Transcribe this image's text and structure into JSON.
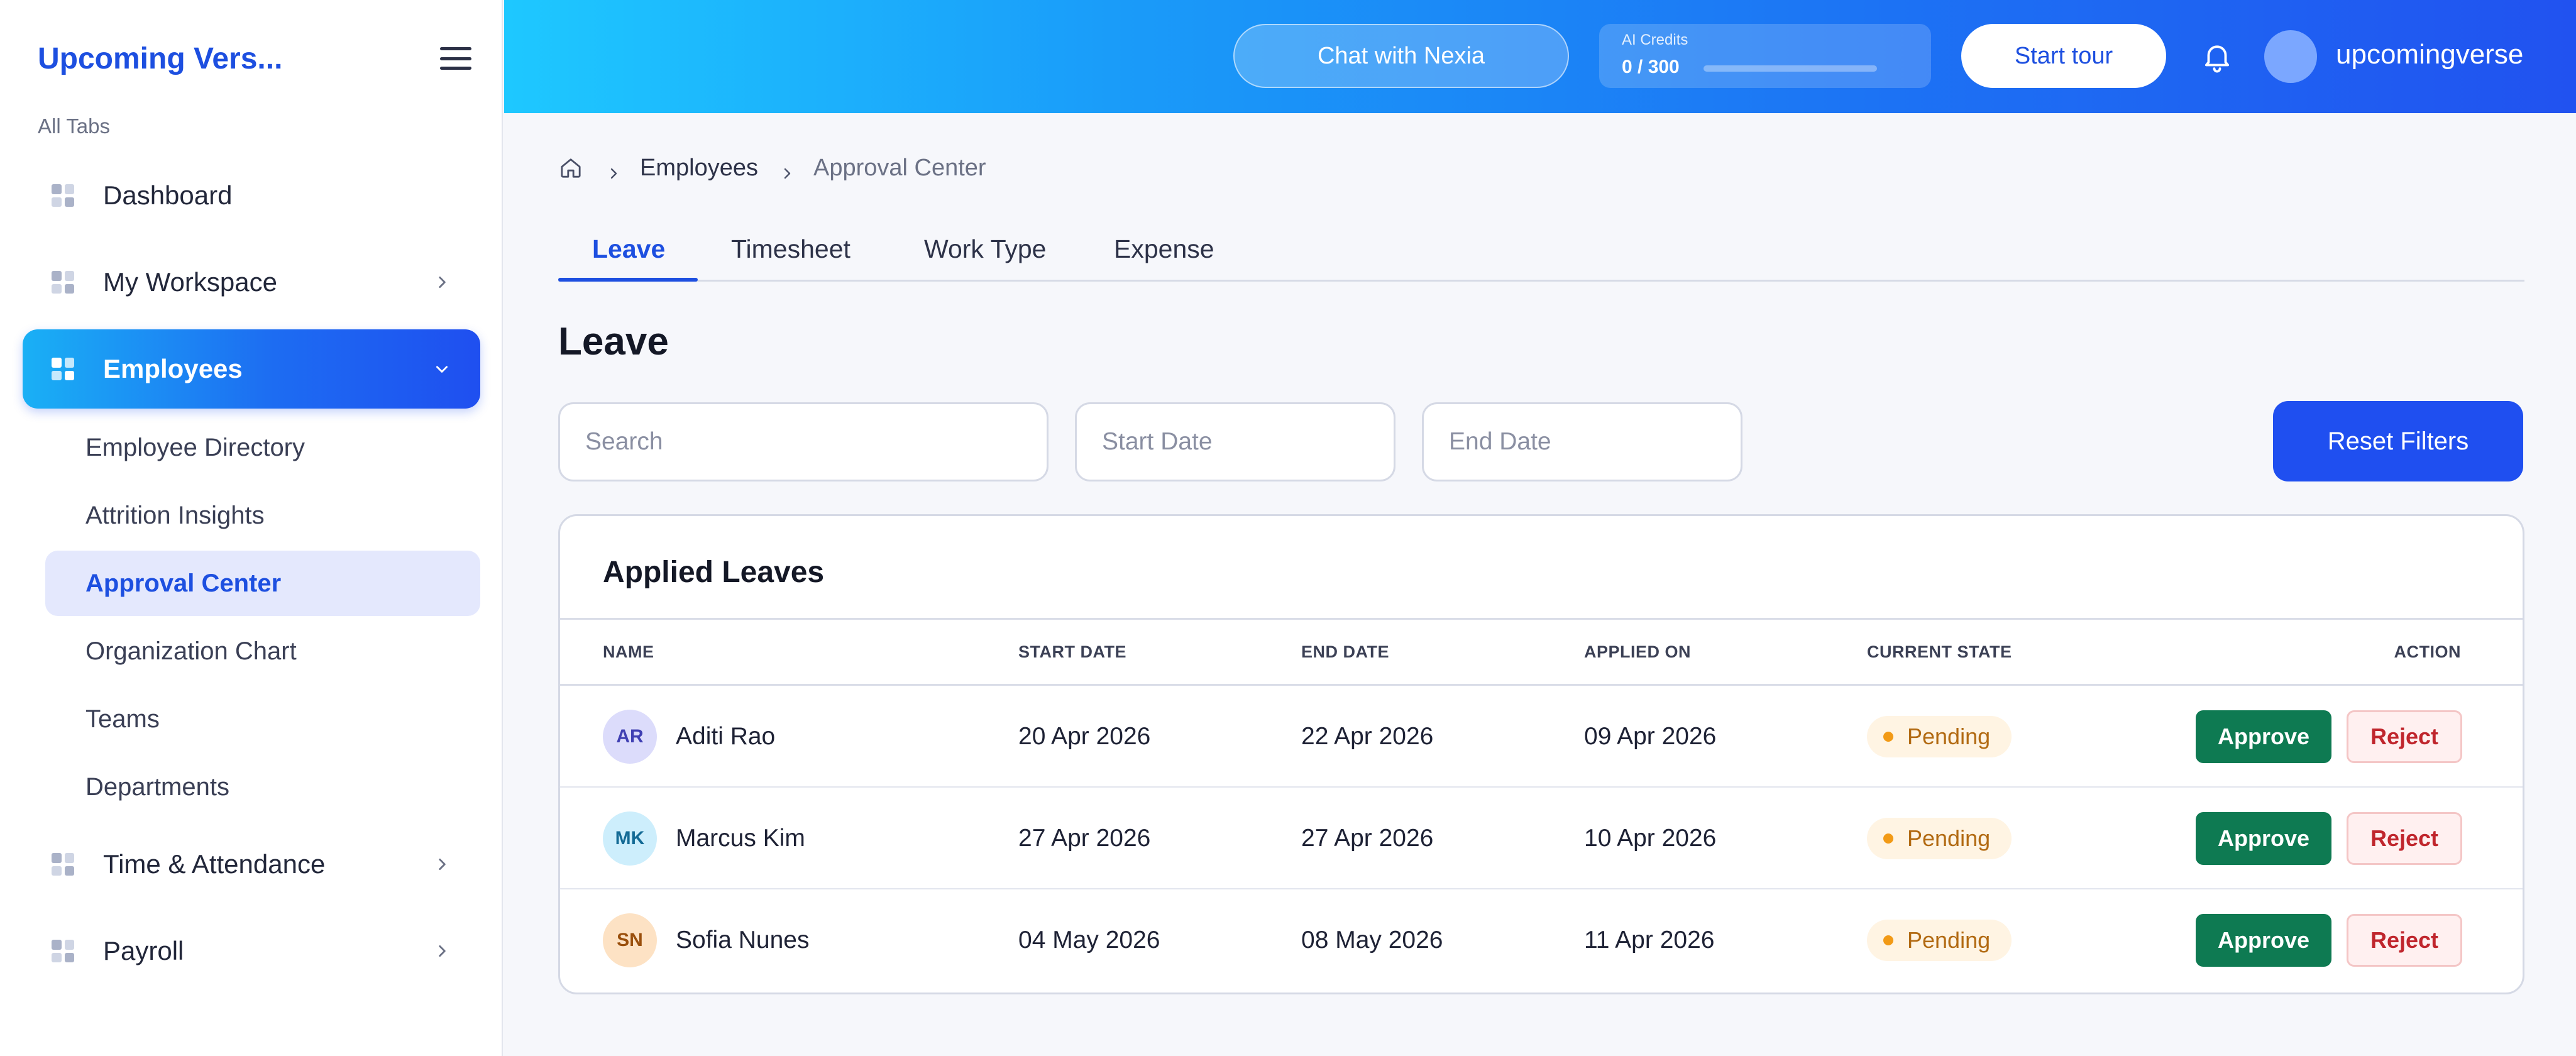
{
  "sidebar": {
    "brand": "Upcoming Vers...",
    "section_label": "All Tabs",
    "items": {
      "dashboard": "Dashboard",
      "workspace": "My Workspace",
      "employees": "Employees",
      "time_attendance": "Time & Attendance",
      "payroll": "Payroll"
    },
    "sub_items": [
      "Employee Directory",
      "Attrition Insights",
      "Approval Center",
      "Organization Chart",
      "Teams",
      "Departments"
    ],
    "active_sub_item": "Approval Center"
  },
  "topbar": {
    "chat_label": "Chat with Nexia",
    "credits_caption": "AI Credits",
    "credits_value": "0 / 300",
    "credits_fraction": 0,
    "tour_label": "Start tour",
    "username": "upcomingverse"
  },
  "breadcrumb": {
    "parent": "Employees",
    "current": "Approval Center"
  },
  "tabs": [
    "Leave",
    "Timesheet",
    "Work Type",
    "Expense"
  ],
  "active_tab": "Leave",
  "page_title": "Leave",
  "filters": {
    "search_placeholder": "Search",
    "start_placeholder": "Start Date",
    "end_placeholder": "End Date",
    "reset_label": "Reset Filters"
  },
  "table": {
    "title": "Applied Leaves",
    "columns": {
      "name": "NAME",
      "start": "START DATE",
      "end": "END DATE",
      "applied": "APPLIED ON",
      "state": "CURRENT STATE",
      "action": "ACTION"
    },
    "approve_label": "Approve",
    "reject_label": "Reject",
    "rows": [
      {
        "initials": "AR",
        "name": "Aditi Rao",
        "start": "20 Apr 2026",
        "end": "22 Apr 2026",
        "applied": "09 Apr 2026",
        "state": "Pending",
        "avatar_bg": "#dcdcfb",
        "avatar_fg": "#3f3fb3"
      },
      {
        "initials": "MK",
        "name": "Marcus Kim",
        "start": "27 Apr 2026",
        "end": "27 Apr 2026",
        "applied": "10 Apr 2026",
        "state": "Pending",
        "avatar_bg": "#cdeefc",
        "avatar_fg": "#136a95"
      },
      {
        "initials": "SN",
        "name": "Sofia Nunes",
        "start": "04 May 2026",
        "end": "08 May 2026",
        "applied": "11 Apr 2026",
        "state": "Pending",
        "avatar_bg": "#fde2c4",
        "avatar_fg": "#9a4f0c"
      }
    ]
  },
  "colors": {
    "accent": "#1d4fe0",
    "approve": "#0e7a52",
    "reject": "#c0262d",
    "pending": "#f29a16"
  },
  "icons": {
    "menu": "hamburger-icon",
    "nav": "grid-icon",
    "expand": "chevron-right-icon",
    "collapse": "chevron-down-icon",
    "home": "home-icon",
    "separator": "chevron-right-icon",
    "notifications": "bell-icon"
  }
}
